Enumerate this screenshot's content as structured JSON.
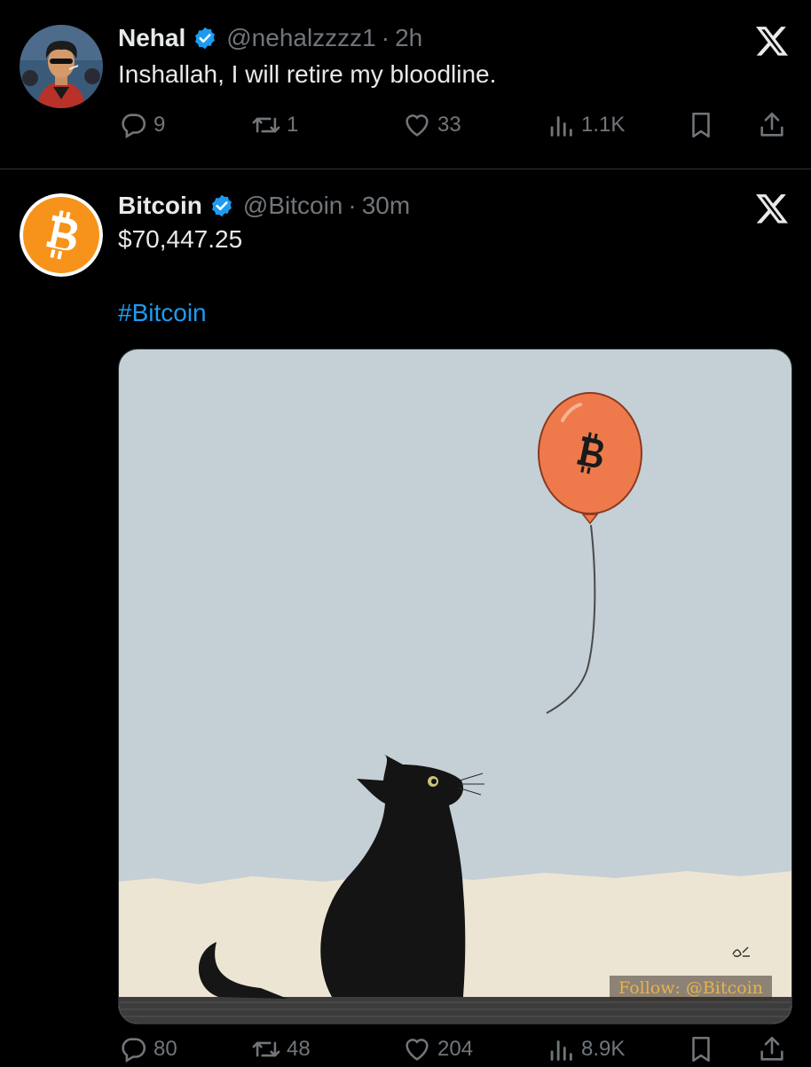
{
  "tweets": [
    {
      "author_name": "Nehal",
      "handle": "@nehalzzzz1",
      "separator": "·",
      "time": "2h",
      "text": "Inshallah, I will retire my bloodline.",
      "avatar_icon": "profile-avatar-illustration",
      "stats": {
        "replies": "9",
        "retweets": "1",
        "likes": "33",
        "views": "1.1K"
      }
    },
    {
      "author_name": "Bitcoin",
      "handle": "@Bitcoin",
      "separator": "·",
      "time": "30m",
      "text": "$70,447.25",
      "hashtag": "#Bitcoin",
      "avatar_icon": "bitcoin-logo",
      "media": {
        "description_icon": "cat-looking-at-bitcoin-balloon",
        "watermark": "Follow: @Bitcoin",
        "signature": "ak"
      },
      "stats": {
        "replies": "80",
        "retweets": "48",
        "likes": "204",
        "views": "8.9K"
      }
    }
  ],
  "colors": {
    "background": "#000000",
    "text_primary": "#e7e9ea",
    "text_secondary": "#71767b",
    "link": "#1d9bf0",
    "verified": "#1d9bf0",
    "bitcoin_orange": "#f7931a",
    "balloon": "#ee7a4c"
  },
  "icons": [
    "reply-icon",
    "retweet-icon",
    "like-icon",
    "views-icon",
    "bookmark-icon",
    "share-icon",
    "x-logo-icon",
    "verified-badge-icon"
  ]
}
